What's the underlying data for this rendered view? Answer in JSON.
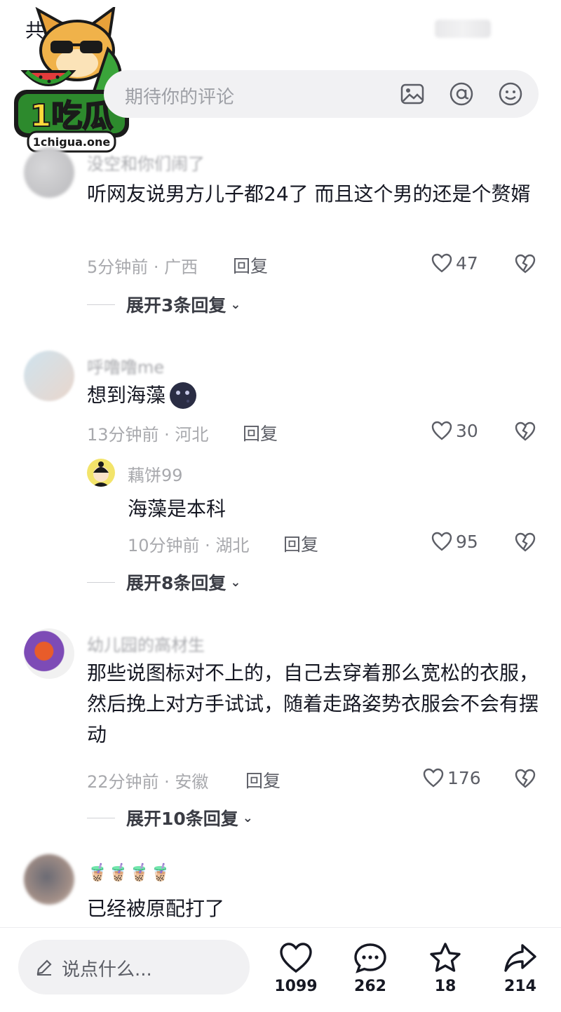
{
  "header": {
    "title": "共 评论"
  },
  "input": {
    "placeholder": "期待你的评论"
  },
  "comments": [
    {
      "username": "没空和你们闹了",
      "text": "听网友说男方儿子都24了 而且这个男的还是个赘婿",
      "time": "5分钟前 · 广西",
      "reply_label": "回复",
      "likes": "47",
      "expand": "展开3条回复"
    },
    {
      "username": "呼噜噜me",
      "text": "想到海藻",
      "time": "13分钟前 · 河北",
      "reply_label": "回复",
      "likes": "30",
      "sub_reply": {
        "username": "藕饼99",
        "text": "海藻是本科",
        "time": "10分钟前 · 湖北",
        "reply_label": "回复",
        "likes": "95"
      },
      "expand": "展开8条回复"
    },
    {
      "username": "幼儿园的高材生",
      "text": "那些说图标对不上的，自己去穿着那么宽松的衣服，然后挽上对方手试试，随着走路姿势衣服会不会有摆动",
      "time": "22分钟前 · 安徽",
      "reply_label": "回复",
      "likes": "176",
      "expand": "展开10条回复"
    },
    {
      "username": "🧋🧋🧋🧋",
      "text": "已经被原配打了"
    }
  ],
  "bottom_bar": {
    "placeholder": "说点什么...",
    "like_count": "1099",
    "comment_count": "262",
    "favorite_count": "18",
    "share_count": "214"
  },
  "logo": {
    "brand": "1吃瓜",
    "url": "1chigua.one"
  }
}
